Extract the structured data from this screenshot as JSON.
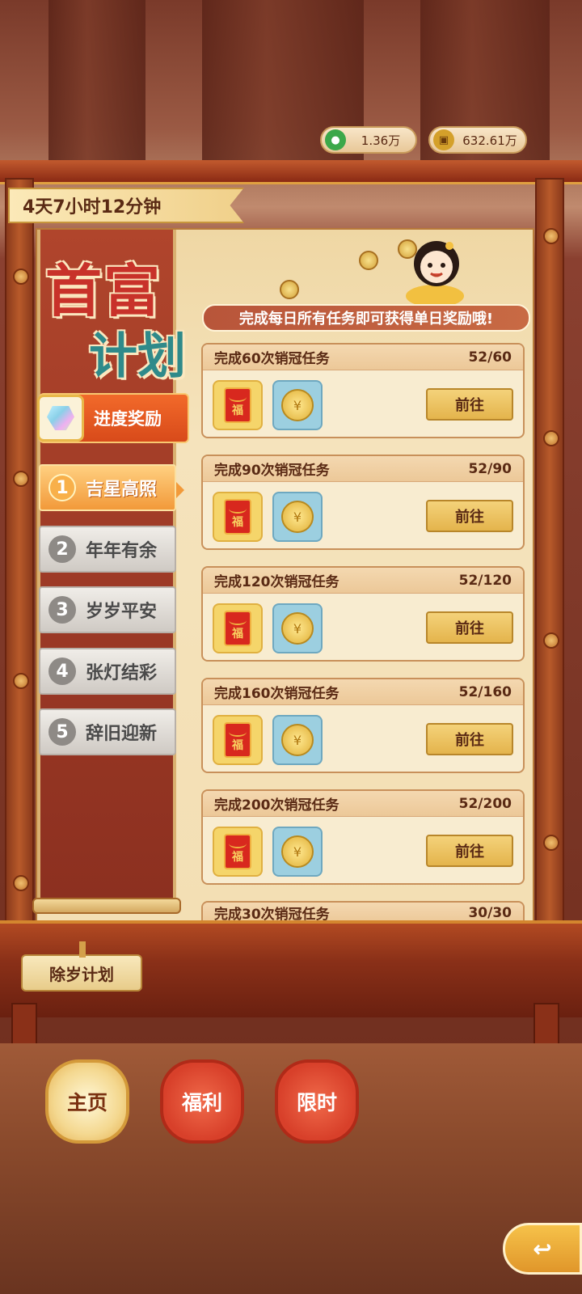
{
  "currency": {
    "jade": {
      "value": "1.36万",
      "icon": "jade-coin-icon"
    },
    "copper": {
      "value": "632.61万",
      "icon": "copper-coin-icon"
    }
  },
  "timer": "4天7小时12分钟",
  "title": {
    "line1": "首富",
    "line2": "计划"
  },
  "progress_reward_label": "进度奖励",
  "stages": [
    {
      "num": "1",
      "label": "吉星高照",
      "active": true
    },
    {
      "num": "2",
      "label": "年年有余",
      "active": false
    },
    {
      "num": "3",
      "label": "岁岁平安",
      "active": false
    },
    {
      "num": "4",
      "label": "张灯结彩",
      "active": false
    },
    {
      "num": "5",
      "label": "辞旧迎新",
      "active": false
    }
  ],
  "hint": "完成每日所有任务即可获得单日奖励哦!",
  "tasks": [
    {
      "title": "完成60次销冠任务",
      "progress": "52/60",
      "button": "前往"
    },
    {
      "title": "完成90次销冠任务",
      "progress": "52/90",
      "button": "前往"
    },
    {
      "title": "完成120次销冠任务",
      "progress": "52/120",
      "button": "前往"
    },
    {
      "title": "完成160次销冠任务",
      "progress": "52/160",
      "button": "前往"
    },
    {
      "title": "完成200次销冠任务",
      "progress": "52/200",
      "button": "前往"
    },
    {
      "title": "完成30次销冠任务",
      "progress": "30/30"
    }
  ],
  "reward_icons": {
    "red_envelope_text": "福",
    "coin_text": "¥"
  },
  "plan_tag": "除岁计划",
  "nav": {
    "home": "主页",
    "welfare": "福利",
    "limited": "限时"
  },
  "back_icon": "back-arrow-icon"
}
